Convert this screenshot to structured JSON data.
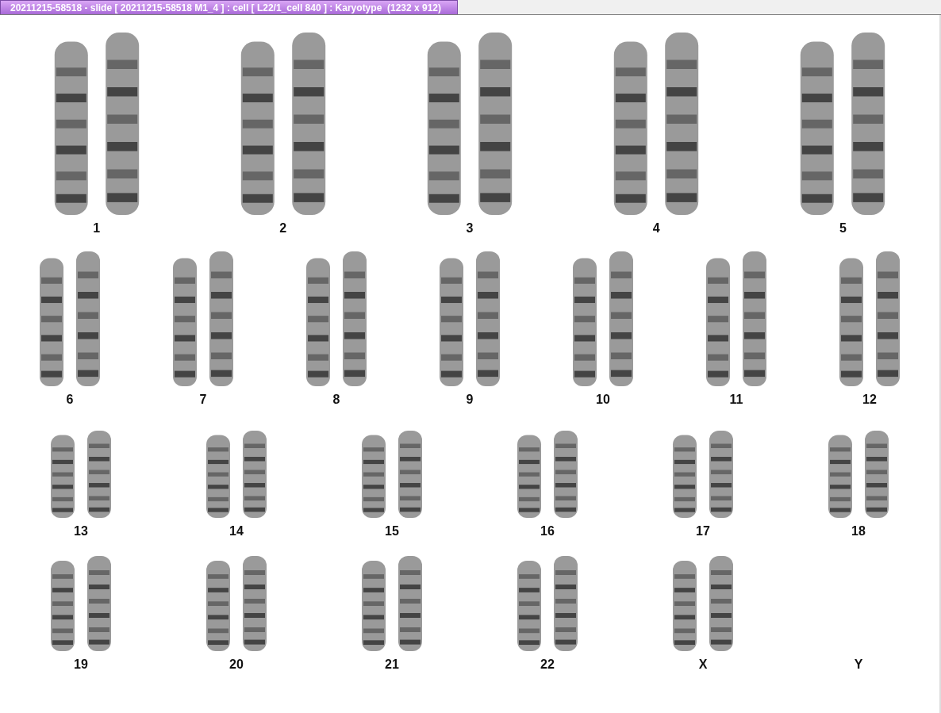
{
  "window": {
    "title": "20211215-58518 - slide [ 20211215-58518 M1_4 ] : cell [ L22/1_cell 840 ] : Karyotype  (1232 x 912)"
  },
  "karyotype": {
    "rows": [
      [
        {
          "label": "1",
          "has_image": true
        },
        {
          "label": "2",
          "has_image": true
        },
        {
          "label": "3",
          "has_image": true
        },
        {
          "label": "4",
          "has_image": true
        },
        {
          "label": "5",
          "has_image": true
        }
      ],
      [
        {
          "label": "6",
          "has_image": true
        },
        {
          "label": "7",
          "has_image": true
        },
        {
          "label": "8",
          "has_image": true
        },
        {
          "label": "9",
          "has_image": true
        },
        {
          "label": "10",
          "has_image": true
        },
        {
          "label": "11",
          "has_image": true
        },
        {
          "label": "12",
          "has_image": true
        }
      ],
      [
        {
          "label": "13",
          "has_image": true
        },
        {
          "label": "14",
          "has_image": true
        },
        {
          "label": "15",
          "has_image": true
        },
        {
          "label": "16",
          "has_image": true
        },
        {
          "label": "17",
          "has_image": true
        },
        {
          "label": "18",
          "has_image": true
        }
      ],
      [
        {
          "label": "19",
          "has_image": true
        },
        {
          "label": "20",
          "has_image": true
        },
        {
          "label": "21",
          "has_image": true
        },
        {
          "label": "22",
          "has_image": true
        },
        {
          "label": "X",
          "has_image": true
        },
        {
          "label": "Y",
          "has_image": false
        }
      ]
    ]
  }
}
